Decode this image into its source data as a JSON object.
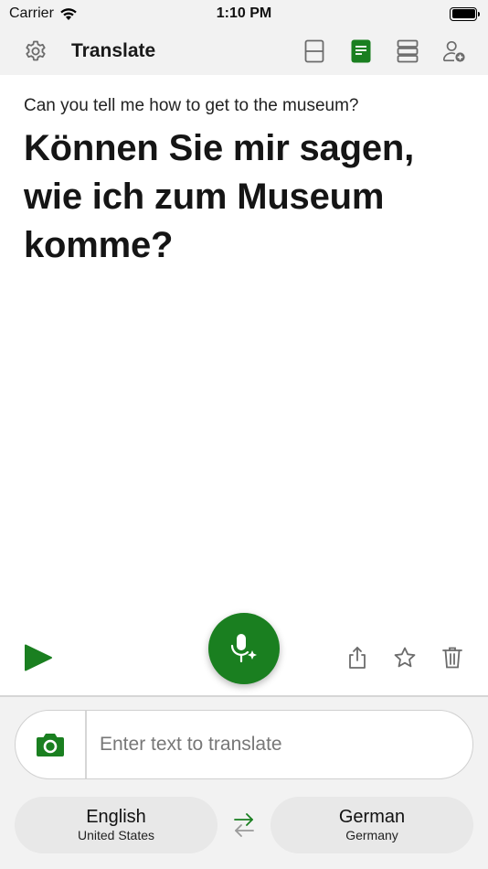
{
  "status_bar": {
    "carrier": "Carrier",
    "time": "1:10 PM"
  },
  "header": {
    "title": "Translate"
  },
  "content": {
    "source_text": "Can you tell me how to get to the museum?",
    "translated_text": "Können Sie mir sagen, wie ich zum Museum komme?"
  },
  "input": {
    "placeholder": "Enter text to translate",
    "value": ""
  },
  "languages": {
    "source": {
      "name": "English",
      "region": "United States"
    },
    "target": {
      "name": "German",
      "region": "Germany"
    }
  },
  "colors": {
    "accent": "#1a7f20",
    "header_bg": "#f2f2f2",
    "icon_gray": "#6b6b6b"
  },
  "icons": {
    "settings": "gear-icon",
    "split_view": "split-view-icon",
    "document_view": "document-view-icon",
    "list_view": "list-view-icon",
    "add_person": "add-person-icon",
    "play": "play-icon",
    "microphone": "microphone-sparkle-icon",
    "share": "share-icon",
    "favorite": "star-icon",
    "delete": "trash-icon",
    "camera": "camera-icon",
    "swap": "swap-arrows-icon"
  }
}
